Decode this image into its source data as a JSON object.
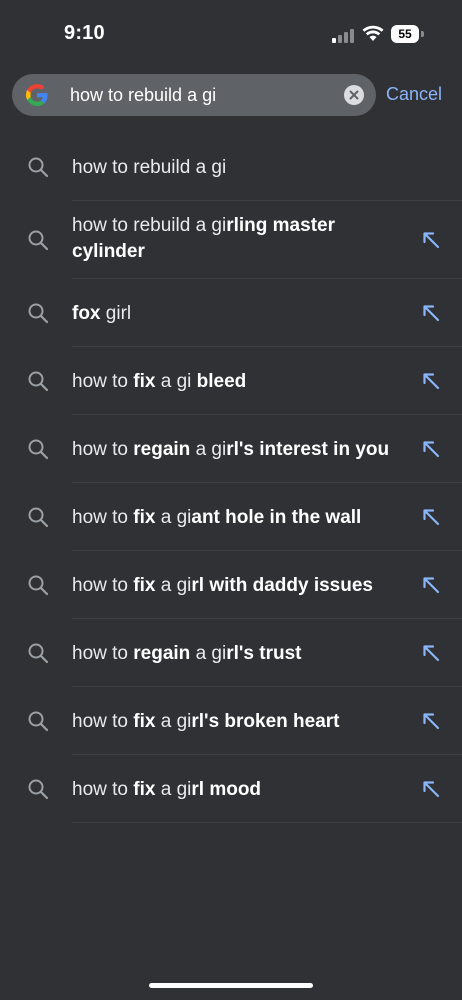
{
  "status_bar": {
    "time": "9:10",
    "battery": "55"
  },
  "search": {
    "query": "how to rebuild a gi",
    "cancel_label": "Cancel"
  },
  "suggestions": [
    {
      "parts": [
        {
          "t": "how to rebuild a gi",
          "b": false
        }
      ],
      "arrow": false
    },
    {
      "parts": [
        {
          "t": "how to rebuild a gi",
          "b": false
        },
        {
          "t": "rling master cylinder",
          "b": true
        }
      ],
      "arrow": true
    },
    {
      "parts": [
        {
          "t": "fox",
          "b": true
        },
        {
          "t": " girl",
          "b": false
        }
      ],
      "arrow": true
    },
    {
      "parts": [
        {
          "t": "how to ",
          "b": false
        },
        {
          "t": "fix",
          "b": true
        },
        {
          "t": " a gi ",
          "b": false
        },
        {
          "t": "bleed",
          "b": true
        }
      ],
      "arrow": true
    },
    {
      "parts": [
        {
          "t": "how to ",
          "b": false
        },
        {
          "t": "regain",
          "b": true
        },
        {
          "t": " a gi",
          "b": false
        },
        {
          "t": "rl's interest in you",
          "b": true
        }
      ],
      "arrow": true
    },
    {
      "parts": [
        {
          "t": "how to ",
          "b": false
        },
        {
          "t": "fix",
          "b": true
        },
        {
          "t": " a gi",
          "b": false
        },
        {
          "t": "ant hole in the wall",
          "b": true
        }
      ],
      "arrow": true
    },
    {
      "parts": [
        {
          "t": "how to ",
          "b": false
        },
        {
          "t": "fix",
          "b": true
        },
        {
          "t": " a gi",
          "b": false
        },
        {
          "t": "rl with daddy issues",
          "b": true
        }
      ],
      "arrow": true
    },
    {
      "parts": [
        {
          "t": "how to ",
          "b": false
        },
        {
          "t": "regain",
          "b": true
        },
        {
          "t": " a gi",
          "b": false
        },
        {
          "t": "rl's trust",
          "b": true
        }
      ],
      "arrow": true
    },
    {
      "parts": [
        {
          "t": "how to ",
          "b": false
        },
        {
          "t": "fix",
          "b": true
        },
        {
          "t": " a gi",
          "b": false
        },
        {
          "t": "rl's broken heart",
          "b": true
        }
      ],
      "arrow": true
    },
    {
      "parts": [
        {
          "t": "how to ",
          "b": false
        },
        {
          "t": "fix",
          "b": true
        },
        {
          "t": " a gi",
          "b": false
        },
        {
          "t": "rl mood",
          "b": true
        }
      ],
      "arrow": true
    }
  ],
  "colors": {
    "background": "#303134",
    "search_bar": "#5f6368",
    "accent": "#8ab4f8",
    "text": "#e8eaed"
  },
  "icons": {
    "search": "search-icon",
    "fill": "arrow-up-left-icon",
    "clear": "clear-icon",
    "logo": "google-g-logo"
  }
}
